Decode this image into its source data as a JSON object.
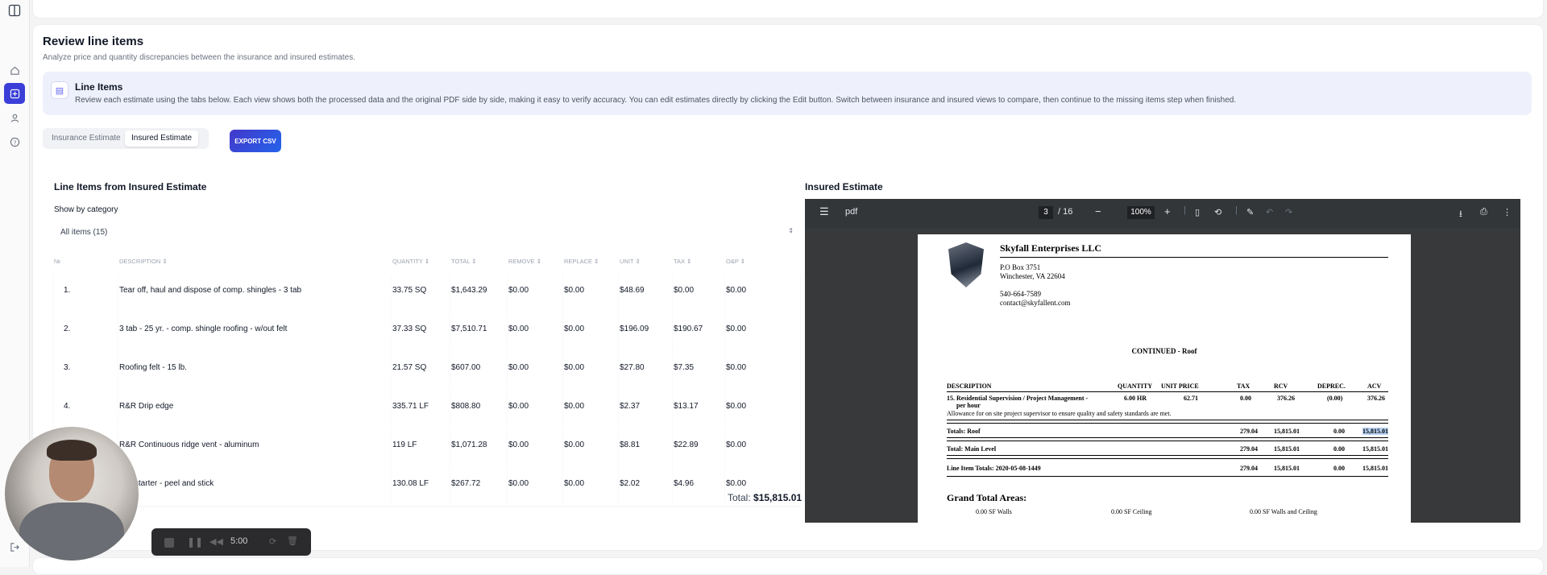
{
  "header": {
    "title": "Review line items",
    "subtitle": "Analyze price and quantity discrepancies between the insurance and insured estimates."
  },
  "banner": {
    "icon": "document-icon",
    "title": "Line Items",
    "description": "Review each estimate using the tabs below. Each view shows both the processed data and the original PDF side by side, making it easy to verify accuracy. You can edit estimates directly by clicking the Edit button. Switch between insurance and insured views to compare, then continue to the missing items step when finished."
  },
  "tabs": [
    {
      "label": "Insurance Estimate",
      "selected": false
    },
    {
      "label": "Insured Estimate",
      "selected": true
    }
  ],
  "export_label": "EXPORT CSV",
  "left_panel": {
    "title": "Line Items from Insured Estimate",
    "category_label": "Show by category",
    "category_value": "All items (15)",
    "columns": [
      "№",
      "DESCRIPTION ⇕",
      "QUANTITY ⇕",
      "TOTAL ⇕",
      "REMOVE ⇕",
      "REPLACE ⇕",
      "UNIT ⇕",
      "TAX ⇕",
      "O&P ⇕"
    ],
    "rows": [
      {
        "num": "1.",
        "desc": "Tear off, haul and dispose of comp. shingles - 3 tab",
        "qty": "33.75 SQ",
        "total": "$1,643.29",
        "remove": "$0.00",
        "replace": "$0.00",
        "unit": "$48.69",
        "tax": "$0.00",
        "op": "$0.00"
      },
      {
        "num": "2.",
        "desc": "3 tab - 25 yr. - comp. shingle roofing - w/out felt",
        "qty": "37.33 SQ",
        "total": "$7,510.71",
        "remove": "$0.00",
        "replace": "$0.00",
        "unit": "$196.09",
        "tax": "$190.67",
        "op": "$0.00"
      },
      {
        "num": "3.",
        "desc": "Roofing felt - 15 lb.",
        "qty": "21.57 SQ",
        "total": "$607.00",
        "remove": "$0.00",
        "replace": "$0.00",
        "unit": "$27.80",
        "tax": "$7.35",
        "op": "$0.00"
      },
      {
        "num": "4.",
        "desc": "R&R Drip edge",
        "qty": "335.71 LF",
        "total": "$808.80",
        "remove": "$0.00",
        "replace": "$0.00",
        "unit": "$2.37",
        "tax": "$13.17",
        "op": "$0.00"
      },
      {
        "num": "5.",
        "desc": "R&R Continuous ridge vent - aluminum",
        "qty": "119 LF",
        "total": "$1,071.28",
        "remove": "$0.00",
        "replace": "$0.00",
        "unit": "$8.81",
        "tax": "$22.89",
        "op": "$0.00"
      },
      {
        "num": "6.",
        "desc": "halt starter - peel and stick",
        "qty": "130.08 LF",
        "total": "$267.72",
        "remove": "$0.00",
        "replace": "$0.00",
        "unit": "$2.02",
        "tax": "$4.96",
        "op": "$0.00"
      }
    ],
    "total_label": "Total:",
    "total_value": "$15,815.01"
  },
  "right_panel": {
    "title": "Insured Estimate",
    "viewer": {
      "file": "pdf",
      "page": "3",
      "pages": "/ 16",
      "zoom": "100%"
    },
    "doc": {
      "company": "Skyfall Enterprises LLC",
      "address1": "P.O Box 3751",
      "address2": "Winchester, VA 22604",
      "phone": "540-664-7589",
      "email": "contact@skyfallent.com",
      "continued": "CONTINUED - Roof",
      "headers": [
        "DESCRIPTION",
        "QUANTITY",
        "UNIT PRICE",
        "TAX",
        "RCV",
        "DEPREC.",
        "ACV"
      ],
      "item_desc": "15.  Residential Supervision / Project Management -",
      "item_desc2": "per hour",
      "item_qty": "6.00 HR",
      "item_unit": "62.71",
      "item_tax": "0.00",
      "item_rcv": "376.26",
      "item_dep": "(0.00)",
      "item_acv": "376.26",
      "item_note": "Allowance for on site project supervisor to ensure quality and safety standards are met.",
      "totals": [
        {
          "label": "Totals:  Roof",
          "tax": "279.04",
          "rcv": "15,815.01",
          "dep": "0.00",
          "acv": "15,815.01"
        },
        {
          "label": "Total:  Main Level",
          "tax": "279.04",
          "rcv": "15,815.01",
          "dep": "0.00",
          "acv": "15,815.01"
        },
        {
          "label": "Line Item Totals:  2020-05-08-1449",
          "tax": "279.04",
          "rcv": "15,815.01",
          "dep": "0.00",
          "acv": "15,815.01"
        }
      ],
      "grand_title": "Grand Total Areas:",
      "area1": "0.00  SF Walls",
      "area2": "0.00  SF Ceiling",
      "area3": "0.00  SF Walls and Ceiling"
    }
  },
  "recorder": {
    "time": "5:00"
  }
}
